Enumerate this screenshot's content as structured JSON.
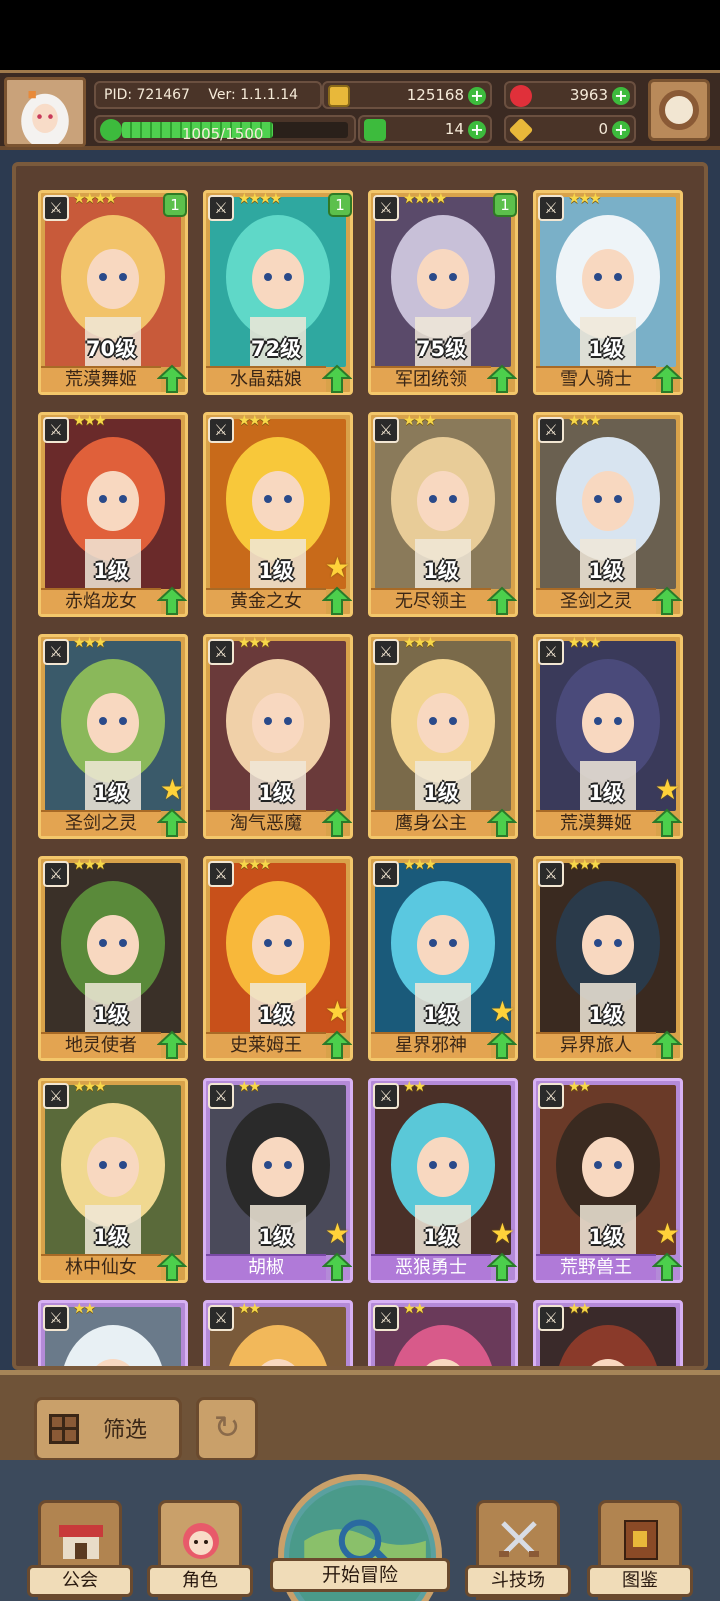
{
  "hud": {
    "pid": "PID: 721467",
    "ver": "Ver: 1.1.1.14",
    "gold": "125168",
    "gems": "3963",
    "exp_text": "1005/1500",
    "exp_fraction": 0.67,
    "clovers": "14",
    "keys": "0",
    "plus": "+",
    "colors": {
      "plus": "#3dbb3d",
      "exp": "#4fd04f"
    }
  },
  "cards": [
    {
      "name": "荒漠舞姬",
      "level": "70级",
      "stars": "★★★★",
      "badge": "1",
      "rarity": "gold",
      "bigstar": false,
      "color": "#c85a3a",
      "hair": "#f2c36a"
    },
    {
      "name": "水晶菇娘",
      "level": "72级",
      "stars": "★★★★",
      "badge": "1",
      "rarity": "gold",
      "bigstar": false,
      "color": "#2fa8a0",
      "hair": "#5fd8c8"
    },
    {
      "name": "军团统领",
      "level": "75级",
      "stars": "★★★★",
      "badge": "1",
      "rarity": "gold",
      "bigstar": false,
      "color": "#5a4a6a",
      "hair": "#c8c0d8"
    },
    {
      "name": "雪人骑士",
      "level": "1级",
      "stars": "★★★",
      "badge": "",
      "rarity": "gold",
      "bigstar": false,
      "color": "#7ab0c8",
      "hair": "#eef4f8"
    },
    {
      "name": "赤焰龙女",
      "level": "1级",
      "stars": "★★★",
      "badge": "",
      "rarity": "gold",
      "bigstar": false,
      "color": "#6a2a2a",
      "hair": "#e0603a"
    },
    {
      "name": "黄金之女",
      "level": "1级",
      "stars": "★★★",
      "badge": "",
      "rarity": "gold",
      "bigstar": true,
      "color": "#c86a1a",
      "hair": "#f8c83a"
    },
    {
      "name": "无尽领主",
      "level": "1级",
      "stars": "★★★",
      "badge": "",
      "rarity": "gold",
      "bigstar": false,
      "color": "#8a7a5a",
      "hair": "#e8cc98"
    },
    {
      "name": "圣剑之灵",
      "level": "1级",
      "stars": "★★★",
      "badge": "",
      "rarity": "gold",
      "bigstar": false,
      "color": "#6a6050",
      "hair": "#d8e4f0"
    },
    {
      "name": "圣剑之灵",
      "level": "1级",
      "stars": "★★★",
      "badge": "",
      "rarity": "gold",
      "bigstar": true,
      "color": "#3a5a6a",
      "hair": "#8ab85a"
    },
    {
      "name": "淘气恶魔",
      "level": "1级",
      "stars": "★★★",
      "badge": "",
      "rarity": "gold",
      "bigstar": false,
      "color": "#6a3a3a",
      "hair": "#f0d0a8"
    },
    {
      "name": "鹰身公主",
      "level": "1级",
      "stars": "★★★",
      "badge": "",
      "rarity": "gold",
      "bigstar": false,
      "color": "#7a6a4a",
      "hair": "#f2d490"
    },
    {
      "name": "荒漠舞姬",
      "level": "1级",
      "stars": "★★★",
      "badge": "",
      "rarity": "gold",
      "bigstar": true,
      "color": "#3a3a5a",
      "hair": "#4a4a7a"
    },
    {
      "name": "地灵使者",
      "level": "1级",
      "stars": "★★★",
      "badge": "",
      "rarity": "gold",
      "bigstar": false,
      "color": "#3a3028",
      "hair": "#5a8a3a"
    },
    {
      "name": "史莱姆王",
      "level": "1级",
      "stars": "★★★",
      "badge": "",
      "rarity": "gold",
      "bigstar": true,
      "color": "#c8501a",
      "hair": "#f8b83a"
    },
    {
      "name": "星界邪神",
      "level": "1级",
      "stars": "★★★",
      "badge": "",
      "rarity": "gold",
      "bigstar": true,
      "color": "#1a5a7a",
      "hair": "#5ac8e0"
    },
    {
      "name": "异界旅人",
      "level": "1级",
      "stars": "★★★",
      "badge": "",
      "rarity": "gold",
      "bigstar": false,
      "color": "#3a2a20",
      "hair": "#2a3a4a"
    },
    {
      "name": "林中仙女",
      "level": "1级",
      "stars": "★★★",
      "badge": "",
      "rarity": "gold",
      "bigstar": false,
      "color": "#5a6a3a",
      "hair": "#f0d890"
    },
    {
      "name": "胡椒",
      "level": "1级",
      "stars": "★★",
      "badge": "",
      "rarity": "purple",
      "bigstar": true,
      "color": "#4a4a5a",
      "hair": "#2a2a2a"
    },
    {
      "name": "恶狼勇士",
      "level": "1级",
      "stars": "★★",
      "badge": "",
      "rarity": "purple",
      "bigstar": true,
      "color": "#4a3028",
      "hair": "#5ac8d8"
    },
    {
      "name": "荒野兽王",
      "level": "1级",
      "stars": "★★",
      "badge": "",
      "rarity": "purple",
      "bigstar": true,
      "color": "#6a3a28",
      "hair": "#3a2a20"
    },
    {
      "name": "",
      "level": "",
      "stars": "★★",
      "badge": "",
      "rarity": "purple",
      "bigstar": false,
      "color": "#6a7a8a",
      "hair": "#e8f0f4"
    },
    {
      "name": "",
      "level": "",
      "stars": "★★",
      "badge": "",
      "rarity": "purple",
      "bigstar": false,
      "color": "#7a5a3a",
      "hair": "#f2b85a"
    },
    {
      "name": "",
      "level": "",
      "stars": "★★",
      "badge": "",
      "rarity": "purple",
      "bigstar": false,
      "color": "#6a3a5a",
      "hair": "#d85a8a"
    },
    {
      "name": "",
      "level": "",
      "stars": "★★",
      "badge": "",
      "rarity": "purple",
      "bigstar": false,
      "color": "#3a2a2a",
      "hair": "#8a3a2a"
    }
  ],
  "filter": {
    "label": "筛选"
  },
  "nav": {
    "guild": "公会",
    "character": "角色",
    "adventure": "开始冒险",
    "arena": "斗技场",
    "codex": "图鉴"
  }
}
